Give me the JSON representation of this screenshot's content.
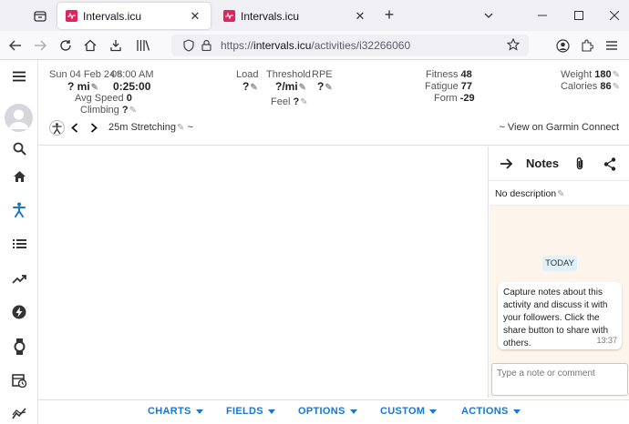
{
  "browser": {
    "tabs": [
      {
        "title": "Intervals.icu",
        "active": true
      },
      {
        "title": "Intervals.icu",
        "active": false
      }
    ],
    "url": {
      "prefix": "https://",
      "domain": "intervals.icu",
      "path": "/activities/i32266060"
    }
  },
  "activity": {
    "date": "Sun 04 Feb 24",
    "time": "08:00 AM",
    "distance": "? mi",
    "duration": "0:25:00",
    "avg_speed_label": "Avg Speed",
    "avg_speed_value": "0",
    "climbing_label": "Climbing",
    "climbing_value": "?",
    "load_label": "Load",
    "load_value": "?",
    "threshold_label": "Threshold",
    "threshold_value": "?/mi",
    "rpe_label": "RPE",
    "rpe_value": "?",
    "feel_label": "Feel",
    "feel_value": "?",
    "fitness_label": "Fitness",
    "fitness_value": "48",
    "fatigue_label": "Fatigue",
    "fatigue_value": "77",
    "form_label": "Form",
    "form_value": "-29",
    "weight_label": "Weight",
    "weight_value": "180",
    "calories_label": "Calories",
    "calories_value": "86",
    "name": "25m Stretching",
    "name_suffix": "~",
    "garmin_link": "~ View on Garmin Connect"
  },
  "notes": {
    "title": "Notes",
    "no_description": "No description",
    "today_label": "TODAY",
    "message": "Capture notes about this activity and discuss it with your followers. Click the share button to share with others.",
    "message_time": "13:37",
    "comment_placeholder": "Type a note or comment"
  },
  "bottom_menu": {
    "charts": "CHARTS",
    "fields": "FIELDS",
    "options": "OPTIONS",
    "custom": "CUSTOM",
    "actions": "ACTIONS"
  },
  "colors": {
    "accent": "#1976d2",
    "brand": "#e0245e",
    "chat_bg": "#fdf5ec",
    "today_bg": "#dff1fb"
  }
}
